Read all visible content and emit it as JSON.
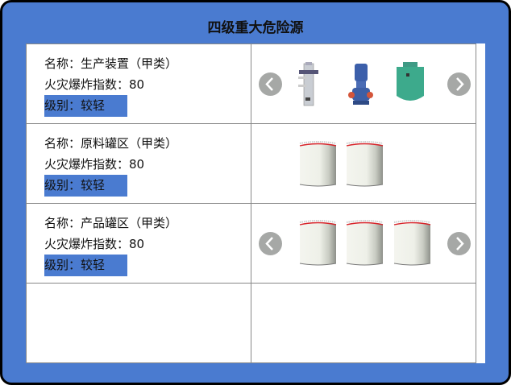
{
  "title": "四级重大危险源",
  "rows": [
    {
      "name": "名称：生产装置（甲类）",
      "index": "火灾爆炸指数：80",
      "level": "级别：较轻",
      "images": [
        "column-equipment",
        "pump",
        "green-vessel"
      ],
      "has_arrows": true
    },
    {
      "name": "名称：原料罐区（甲类）",
      "index": "火灾爆炸指数：80",
      "level": "级别：较轻",
      "images": [
        "tank",
        "tank"
      ],
      "has_arrows": false
    },
    {
      "name": "名称：产品罐区（甲类）",
      "index": "火灾爆炸指数：80",
      "level": "级别：较轻",
      "images": [
        "tank",
        "tank",
        "tank"
      ],
      "has_arrows": true
    }
  ],
  "colors": {
    "background": "#4a7bd0",
    "badge": "#4a7bd0",
    "arrow": "#a6a8a6"
  }
}
